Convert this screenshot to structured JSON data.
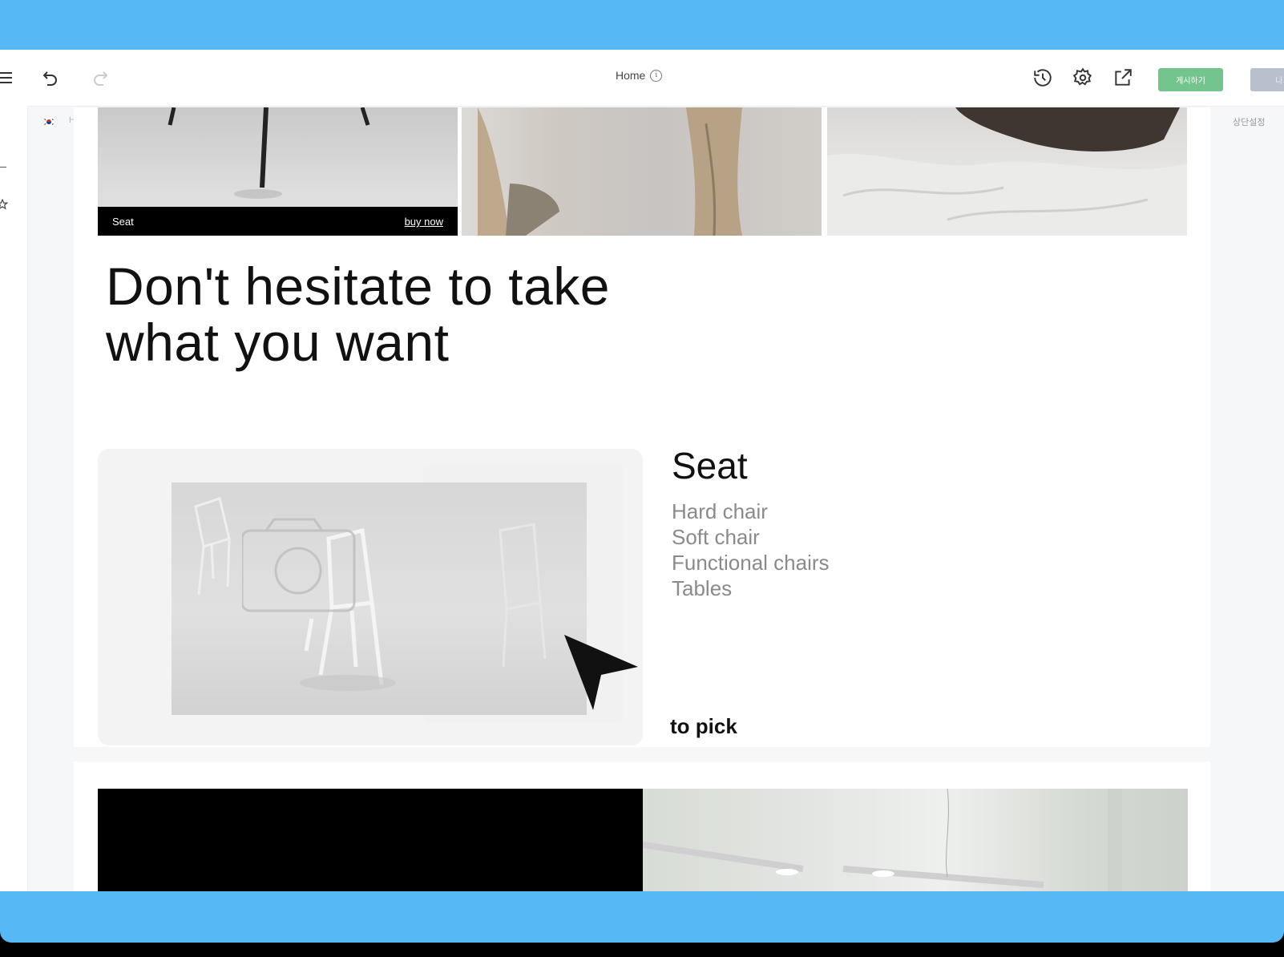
{
  "toolbar": {
    "page_title": "Home",
    "info_glyph": "i",
    "publish_label": "게시하기",
    "exit_label": "나가기"
  },
  "editor": {
    "language_code": "H",
    "top_setting_label": "상단설정"
  },
  "hero_strip": {
    "caption_left": "Seat",
    "caption_right": "buy now"
  },
  "headline": {
    "line1": "Don't hesitate to take",
    "line2": "what you want"
  },
  "category": {
    "title": "Seat",
    "items": [
      "Hard chair",
      "Soft chair",
      "Functional chairs",
      "Tables"
    ],
    "cta": "to pick"
  },
  "colors": {
    "frame": "#56b9f6",
    "publish": "#74c48d",
    "exit": "#b7c0cc"
  }
}
